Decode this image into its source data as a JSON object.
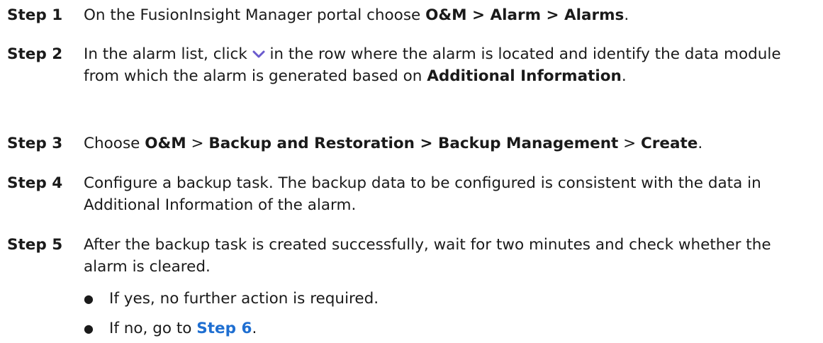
{
  "steps": [
    {
      "label": "Step 1",
      "parts": [
        "On the FusionInsight Manager portal choose ",
        "O&M > Alarm > Alarms",
        "."
      ]
    },
    {
      "label": "Step 2",
      "parts": [
        "In the alarm list, click ",
        " in the row where the alarm is located and identify the data module from which the alarm is generated based on ",
        "Additional Information",
        "."
      ],
      "icon": "chevron-down-icon"
    },
    {
      "label": "Step 3",
      "parts": [
        "Choose ",
        "O&M",
        " > ",
        "Backup and Restoration > Backup Management",
        " > ",
        "Create",
        "."
      ]
    },
    {
      "label": "Step 4",
      "parts": [
        "Configure a backup task. The backup data to be configured is consistent with the data in Additional Information of the alarm."
      ]
    },
    {
      "label": "Step 5",
      "parts": [
        "After the backup task is created successfully, wait for two minutes and check whether the alarm is cleared."
      ]
    }
  ],
  "bullets": [
    {
      "dot": "●",
      "text": "If yes, no further action is required."
    },
    {
      "dot": "●",
      "prefix": "If no, go to ",
      "link": "Step 6",
      "suffix": "."
    }
  ],
  "colors": {
    "text": "#1a1a1a",
    "link": "#1f6fd1",
    "icon": "#6a5acd"
  }
}
